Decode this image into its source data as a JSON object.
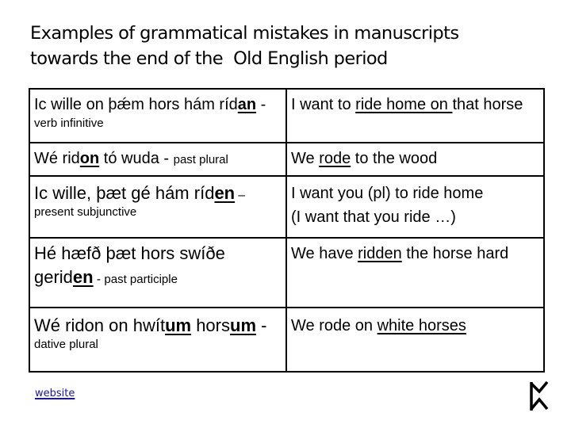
{
  "title": {
    "line1": "Examples of grammatical mistakes in manuscripts",
    "line2": "towards the end of the  Old English period"
  },
  "rows": [
    {
      "oe": {
        "pre": "Ic wille on þǽm hors hám ríd",
        "ending": "an",
        "sep": " - ",
        "label": "verb infinitive"
      },
      "en": {
        "pre": "I want to ",
        "underlined": "ride home on ",
        "post": " that horse"
      }
    },
    {
      "oe": {
        "pre": "Wé rid",
        "ending": "on",
        "post": " tó wuda",
        "sep": " - ",
        "label": "past plural"
      },
      "en": {
        "pre": "We ",
        "underlined": "rode",
        "post": " to the wood"
      }
    },
    {
      "oe": {
        "pre": "Ic wille, þæt gé hám ríd",
        "ending": "en",
        "sep": " – ",
        "label": "present subjunctive"
      },
      "en": {
        "line1": "I want you (pl) to ride home",
        "line2": "(I want that you ride …)"
      }
    },
    {
      "oe": {
        "pre": "Hé hæfð þæt hors swíðe gerid",
        "ending": "en",
        "sep": " - ",
        "label": "past participle"
      },
      "en": {
        "pre": "We have ",
        "underlined": "ridden",
        "post": " the horse hard"
      }
    },
    {
      "oe": {
        "pre": "Wé ridon on hwít",
        "ending": "um",
        "mid": " hors",
        "ending2": "um",
        "sep": " - ",
        "label": "dative plural"
      },
      "en": {
        "pre": "We rode on ",
        "underlined": "white horses"
      }
    }
  ],
  "footer": {
    "link_label": "website",
    "link_color": "#1a1a8c",
    "logo_icon": "rune-peorth-icon"
  }
}
